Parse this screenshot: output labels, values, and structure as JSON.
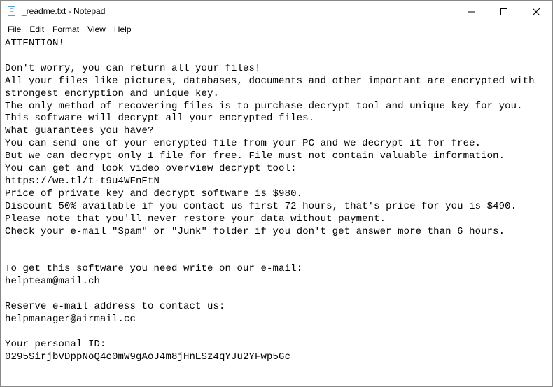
{
  "window": {
    "title": "_readme.txt - Notepad"
  },
  "menu": {
    "file": "File",
    "edit": "Edit",
    "format": "Format",
    "view": "View",
    "help": "Help"
  },
  "body": "ATTENTION!\n\nDon't worry, you can return all your files!\nAll your files like pictures, databases, documents and other important are encrypted with strongest encryption and unique key.\nThe only method of recovering files is to purchase decrypt tool and unique key for you.\nThis software will decrypt all your encrypted files.\nWhat guarantees you have?\nYou can send one of your encrypted file from your PC and we decrypt it for free.\nBut we can decrypt only 1 file for free. File must not contain valuable information.\nYou can get and look video overview decrypt tool:\nhttps://we.tl/t-t9u4WFnEtN\nPrice of private key and decrypt software is $980.\nDiscount 50% available if you contact us first 72 hours, that's price for you is $490.\nPlease note that you'll never restore your data without payment.\nCheck your e-mail \"Spam\" or \"Junk\" folder if you don't get answer more than 6 hours.\n\n\nTo get this software you need write on our e-mail:\nhelpteam@mail.ch\n\nReserve e-mail address to contact us:\nhelpmanager@airmail.cc\n\nYour personal ID:\n0295SirjbVDppNoQ4c0mW9gAoJ4m8jHnESz4qYJu2YFwp5Gc"
}
